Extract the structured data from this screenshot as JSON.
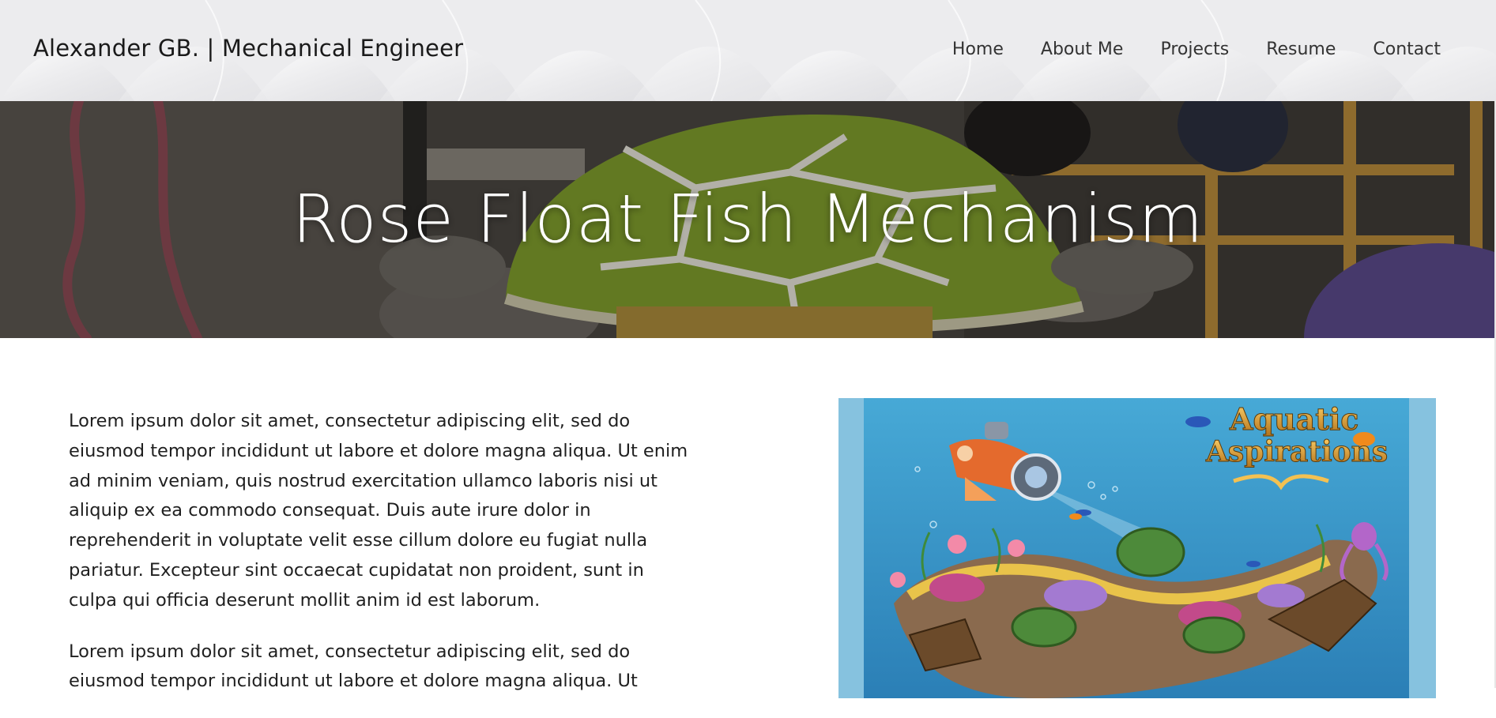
{
  "header": {
    "brand": "Alexander GB. | Mechanical Engineer",
    "nav": [
      "Home",
      "About Me",
      "Projects",
      "Resume",
      "Contact"
    ]
  },
  "hero": {
    "title": "Rose Float Fish Mechanism"
  },
  "main": {
    "paragraphs": [
      "Lorem ipsum dolor sit amet, consectetur adipiscing elit, sed do eiusmod tempor incididunt ut labore et dolore magna aliqua. Ut enim ad minim veniam, quis nostrud exercitation ullamco laboris nisi ut aliquip ex ea commodo consequat. Duis aute irure dolor in reprehenderit in voluptate velit esse cillum dolore eu fugiat nulla pariatur. Excepteur sint occaecat cupidatat non proident, sunt in culpa qui officia deserunt mollit anim id est laborum.",
      "Lorem ipsum dolor sit amet, consectetur adipiscing elit, sed do eiusmod tempor incididunt ut labore et dolore magna aliqua. Ut"
    ],
    "poster": {
      "title_line1": "Aquatic",
      "title_line2": "Aspirations"
    }
  },
  "colors": {
    "header_bg": "#ececee",
    "hero_overlay": "#3d3a37",
    "poster_bg": "#3a9fd0",
    "turtle_green": "#7a9a2a"
  }
}
